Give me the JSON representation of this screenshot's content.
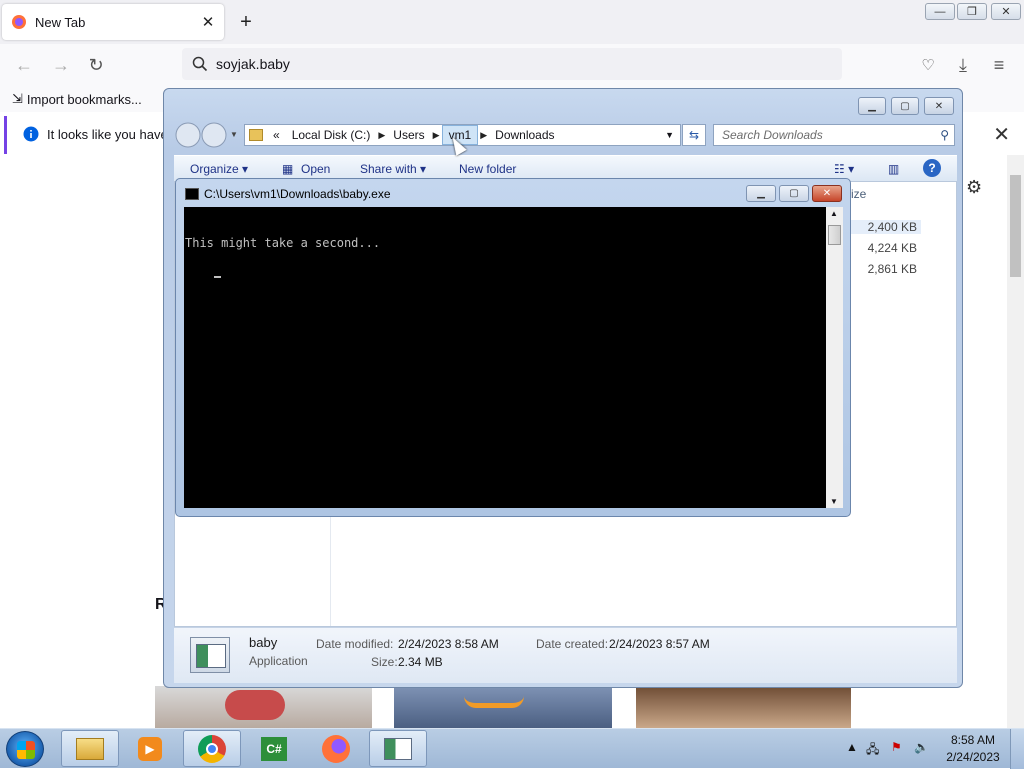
{
  "browser": {
    "tab_title": "New Tab",
    "tab_close": "✕",
    "new_tab": "+",
    "url": "soyjak.baby",
    "bookmark_import": "Import bookmarks...",
    "notice": "It looks like you haven'",
    "notice_close": "✕",
    "recent_partial": "R",
    "window_controls": {
      "minimize": "—",
      "restore": "❐",
      "close": "✕"
    }
  },
  "explorer": {
    "breadcrumbs": [
      "Local Disk (C:)",
      "Users",
      "vm1",
      "Downloads"
    ],
    "overflow": "«",
    "search_placeholder": "Search Downloads",
    "toolbar": {
      "organize": "Organize ▾",
      "open": "Open",
      "share_with": "Share with ▾",
      "new_folder": "New folder"
    },
    "column_size_label": "ize",
    "sizes": [
      "2,400 KB",
      "4,224 KB",
      "2,861 KB"
    ],
    "details": {
      "name": "baby",
      "type": "Application",
      "date_modified_label": "Date modified:",
      "date_modified": "2/24/2023 8:58 AM",
      "date_created_label": "Date created:",
      "date_created": "2/24/2023 8:57 AM",
      "size_label": "Size:",
      "size": "2.34 MB"
    }
  },
  "console": {
    "title": "C:\\Users\\vm1\\Downloads\\baby.exe",
    "output": "This might take a second..."
  },
  "taskbar": {
    "time": "8:58 AM",
    "date": "2/24/2023",
    "apps": [
      "explorer",
      "media-player",
      "chrome",
      "csharp",
      "firefox",
      "console"
    ]
  },
  "colors": {
    "taskbar": "#a9c0dc",
    "terminal_bg": "#000000",
    "terminal_fg": "#c0c0c0",
    "firefox_accent": "#7542e5"
  }
}
